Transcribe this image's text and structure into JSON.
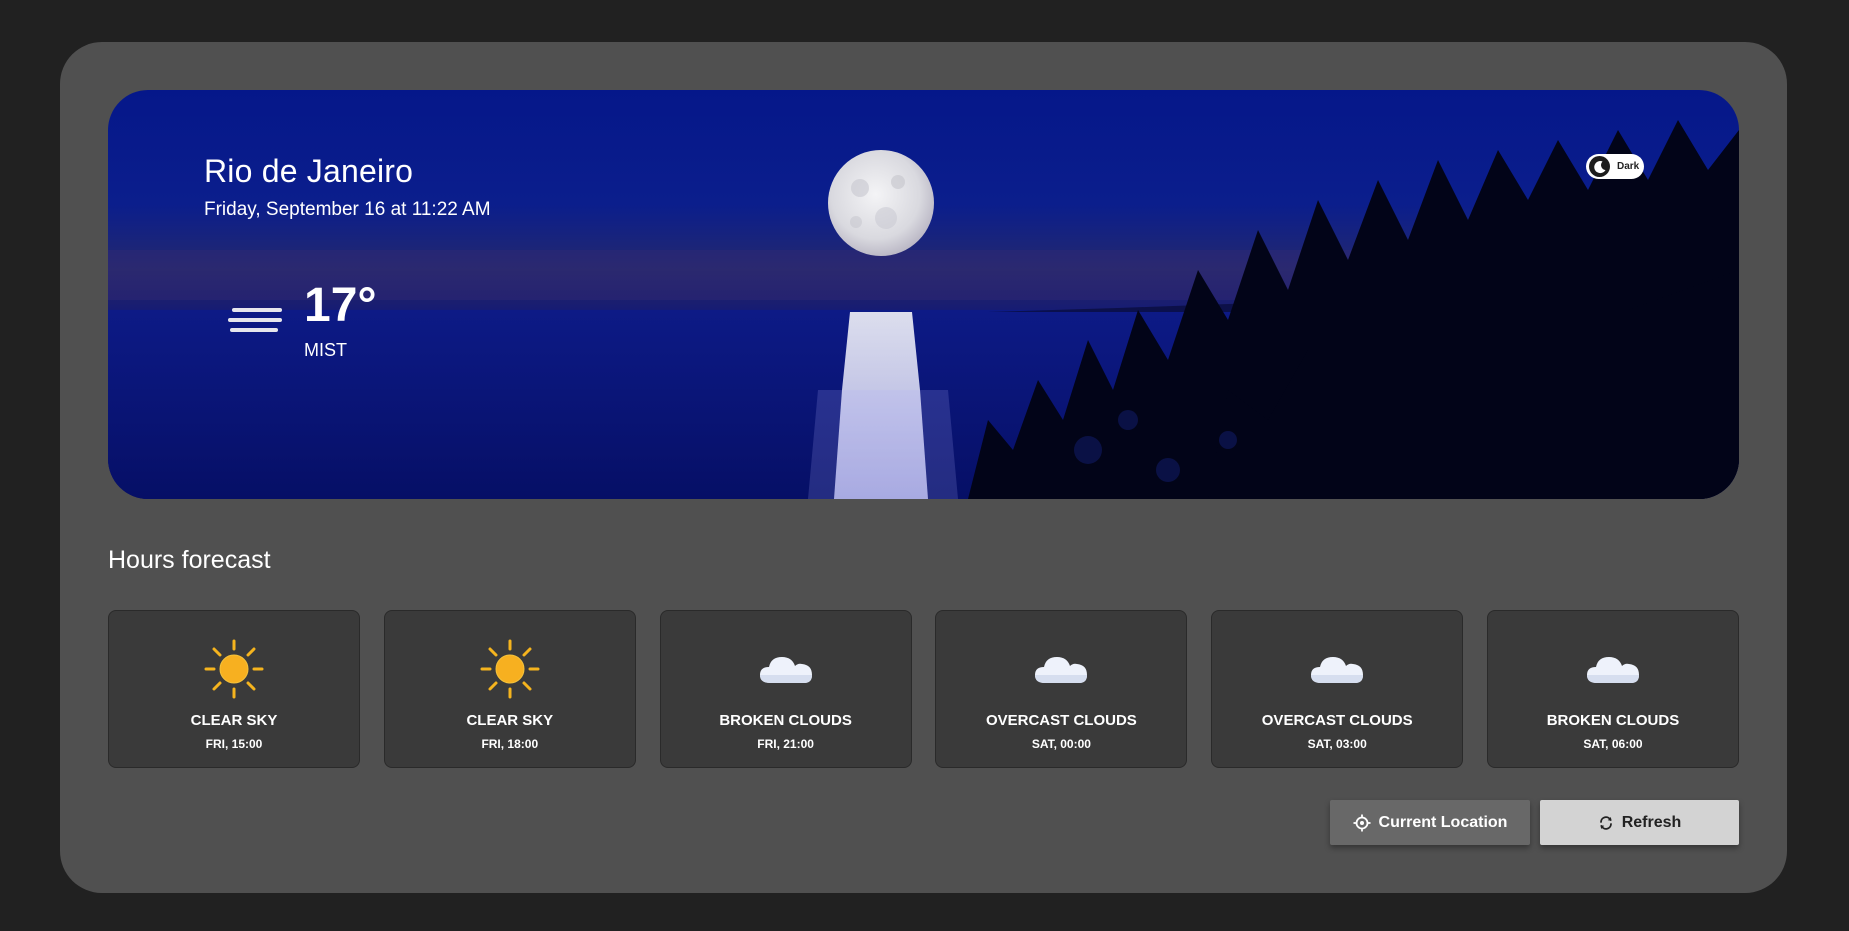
{
  "location": {
    "city": "Rio de Janeiro",
    "datetime": "Friday, September 16 at 11:22 AM"
  },
  "current": {
    "temperature": "17°",
    "condition": "MIST",
    "icon": "mist-icon"
  },
  "theme_toggle": {
    "label": "Dark",
    "icon": "moon-icon"
  },
  "forecast": {
    "title": "Hours forecast",
    "items": [
      {
        "description": "CLEAR SKY",
        "time": "FRI, 15:00",
        "icon": "sun-icon"
      },
      {
        "description": "CLEAR SKY",
        "time": "FRI, 18:00",
        "icon": "sun-icon"
      },
      {
        "description": "BROKEN CLOUDS",
        "time": "FRI, 21:00",
        "icon": "cloud-icon"
      },
      {
        "description": "OVERCAST CLOUDS",
        "time": "SAT, 00:00",
        "icon": "cloud-icon"
      },
      {
        "description": "OVERCAST CLOUDS",
        "time": "SAT, 03:00",
        "icon": "cloud-icon"
      },
      {
        "description": "BROKEN CLOUDS",
        "time": "SAT, 06:00",
        "icon": "cloud-icon"
      }
    ]
  },
  "actions": {
    "current_location_label": "Current Location",
    "current_location_icon": "crosshair-icon",
    "refresh_label": "Refresh",
    "refresh_icon": "refresh-icon"
  },
  "colors": {
    "page_background": "#212121",
    "app_background": "#505050",
    "card_background": "#3a3a3a",
    "sun": "#f5b41e",
    "night_sky": "#0b1e8c"
  }
}
